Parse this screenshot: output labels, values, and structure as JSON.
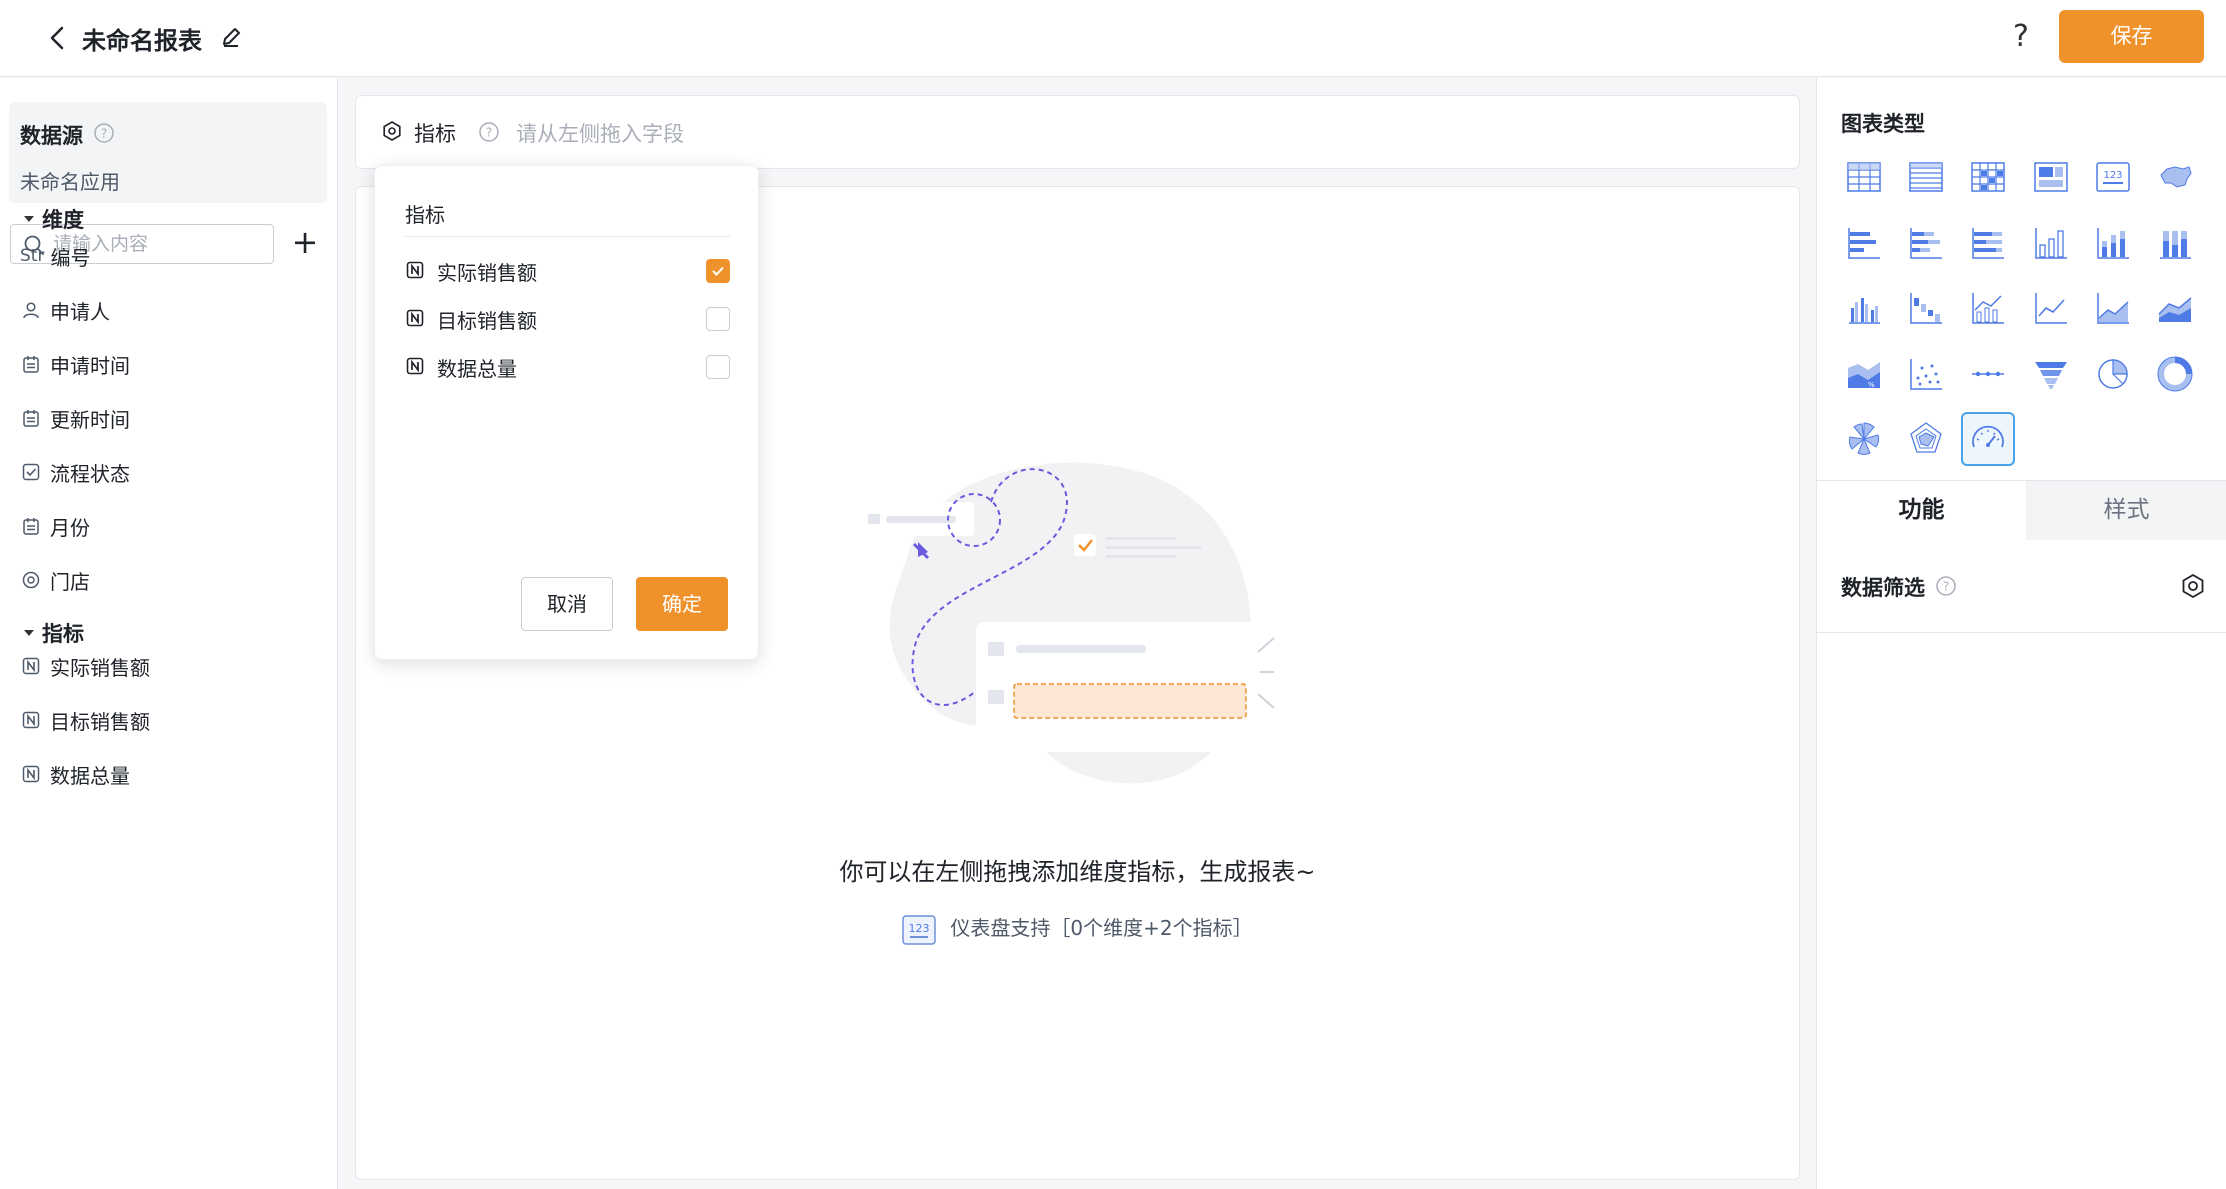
{
  "header": {
    "title": "未命名报表",
    "help": "?",
    "save_label": "保存"
  },
  "sidebar": {
    "datasource_title": "数据源",
    "datasource_app": "未命名应用",
    "search_placeholder": "请输入内容",
    "add": "+",
    "dimension_group": "维度",
    "metric_group": "指标",
    "dimensions": [
      {
        "label": "编号",
        "prefix": "Str",
        "icon": "string-icon"
      },
      {
        "label": "申请人",
        "icon": "user-icon"
      },
      {
        "label": "申请时间",
        "icon": "calendar-icon"
      },
      {
        "label": "更新时间",
        "icon": "calendar-icon"
      },
      {
        "label": "流程状态",
        "icon": "checkbox-icon"
      },
      {
        "label": "月份",
        "icon": "calendar-icon"
      },
      {
        "label": "门店",
        "icon": "radio-icon"
      }
    ],
    "metrics": [
      {
        "label": "实际销售额",
        "icon": "number-icon"
      },
      {
        "label": "目标销售额",
        "icon": "number-icon"
      },
      {
        "label": "数据总量",
        "icon": "number-icon"
      }
    ]
  },
  "metric_bar": {
    "label": "指标",
    "placeholder": "请从左侧拖入字段"
  },
  "popover": {
    "title": "指标",
    "options": [
      {
        "label": "实际销售额",
        "checked": true
      },
      {
        "label": "目标销售额",
        "checked": false
      },
      {
        "label": "数据总量",
        "checked": false
      }
    ],
    "cancel_label": "取消",
    "ok_label": "确定"
  },
  "canvas": {
    "empty_message": "你可以在左侧拖拽添加维度指标，生成报表~",
    "support_text": "仪表盘支持［0个维度+2个指标］",
    "support_icon_text": "123"
  },
  "right_panel": {
    "chart_type_title": "图表类型",
    "selected_chart": "gauge-chart-icon",
    "chart_types": [
      "table-chart-icon",
      "detail-table-chart-icon",
      "pivot-table-chart-icon",
      "dashboard-card-chart-icon",
      "indicator-card-chart-icon",
      "map-chart-icon",
      "bar-horizontal-chart-icon",
      "stacked-bar-horizontal-chart-icon",
      "percent-bar-horizontal-chart-icon",
      "column-chart-icon",
      "stacked-column-chart-icon",
      "percent-column-chart-icon",
      "grouped-column-chart-icon",
      "waterfall-chart-icon",
      "combo-chart-icon",
      "line-chart-icon",
      "area-chart-icon",
      "stacked-area-chart-icon",
      "percent-area-chart-icon",
      "scatter-chart-icon",
      "timeline-chart-icon",
      "funnel-chart-icon",
      "pie-chart-icon",
      "donut-chart-icon",
      "rose-chart-icon",
      "radar-chart-icon",
      "gauge-chart-icon"
    ],
    "tab_function": "功能",
    "tab_style": "样式",
    "filter_label": "数据筛选"
  },
  "colors": {
    "accent": "#f0922c",
    "icon_blue": "#4e7be6",
    "selected_border": "#4aa2e8"
  }
}
